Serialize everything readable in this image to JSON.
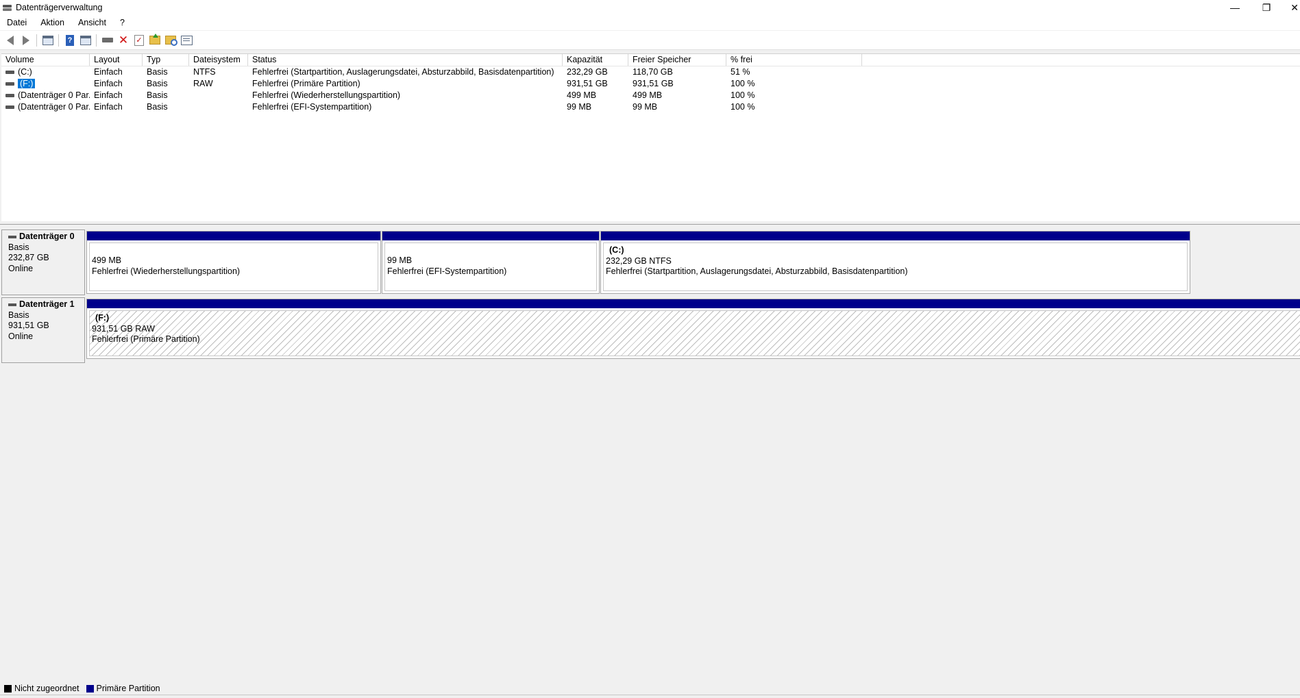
{
  "window": {
    "title": "Datenträgerverwaltung",
    "minimize_glyph": "—",
    "restore_glyph": "❐",
    "close_glyph": "✕"
  },
  "menu": {
    "items": [
      {
        "label": "Datei"
      },
      {
        "label": "Aktion"
      },
      {
        "label": "Ansicht"
      },
      {
        "label": "?"
      }
    ]
  },
  "toolbar": {
    "icons": [
      "back-icon",
      "forward-icon",
      "console-tree-icon",
      "help-icon",
      "show-hide-icon",
      "connect-disk-icon",
      "delete-icon",
      "checklist-icon",
      "folder-up-icon",
      "folder-search-icon",
      "properties-icon"
    ],
    "delete_glyph": "✕",
    "help_glyph": "?",
    "check_glyph": "✓"
  },
  "volume_list": {
    "columns": [
      "Volume",
      "Layout",
      "Typ",
      "Dateisystem",
      "Status",
      "Kapazität",
      "Freier Speicher",
      "% frei"
    ],
    "rows": [
      {
        "volume": "(C:)",
        "layout": "Einfach",
        "typ": "Basis",
        "dateisystem": "NTFS",
        "status": "Fehlerfrei (Startpartition, Auslagerungsdatei, Absturzabbild, Basisdatenpartition)",
        "kapazitaet": "232,29 GB",
        "frei": "118,70 GB",
        "prozent": "51 %"
      },
      {
        "volume": "(F:)",
        "layout": "Einfach",
        "typ": "Basis",
        "dateisystem": "RAW",
        "status": "Fehlerfrei (Primäre Partition)",
        "kapazitaet": "931,51 GB",
        "frei": "931,51 GB",
        "prozent": "100 %"
      },
      {
        "volume": "(Datenträger 0 Par...",
        "layout": "Einfach",
        "typ": "Basis",
        "dateisystem": "",
        "status": "Fehlerfrei (Wiederherstellungspartition)",
        "kapazitaet": "499 MB",
        "frei": "499 MB",
        "prozent": "100 %"
      },
      {
        "volume": "(Datenträger 0 Par...",
        "layout": "Einfach",
        "typ": "Basis",
        "dateisystem": "",
        "status": "Fehlerfrei (EFI-Systempartition)",
        "kapazitaet": "99 MB",
        "frei": "99 MB",
        "prozent": "100 %"
      }
    ]
  },
  "disks": [
    {
      "name": "Datenträger 0",
      "type": "Basis",
      "size": "232,87 GB",
      "state": "Online",
      "partitions": [
        {
          "label": "",
          "size_line": "499 MB",
          "status": "Fehlerfrei (Wiederherstellungspartition)"
        },
        {
          "label": "",
          "size_line": "99 MB",
          "status": "Fehlerfrei (EFI-Systempartition)"
        },
        {
          "label": "(C:)",
          "size_line": "232,29 GB NTFS",
          "status": "Fehlerfrei (Startpartition, Auslagerungsdatei, Absturzabbild, Basisdatenpartition)"
        }
      ]
    },
    {
      "name": "Datenträger 1",
      "type": "Basis",
      "size": "931,51 GB",
      "state": "Online",
      "partitions": [
        {
          "label": "(F:)",
          "size_line": "931,51 GB RAW",
          "status": "Fehlerfrei (Primäre Partition)"
        }
      ]
    }
  ],
  "legend": {
    "items": [
      {
        "label": "Nicht zugeordnet",
        "color": "#000000"
      },
      {
        "label": "Primäre Partition",
        "color": "#00008b"
      }
    ]
  },
  "colors": {
    "partition_bar": "#00008b",
    "selection": "#0078d7"
  }
}
